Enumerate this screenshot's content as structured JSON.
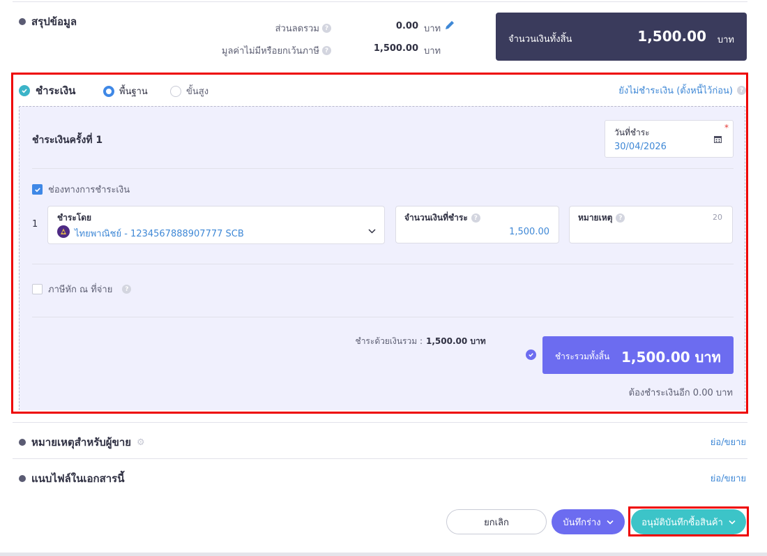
{
  "summary": {
    "title": "สรุปข้อมูล",
    "discount_label": "ส่วนลดรวม",
    "discount_value": "0.00",
    "discount_unit": "บาท",
    "nonvat_label": "มูลค่าไม่มีหรือยกเว้นภาษี",
    "nonvat_value": "1,500.00",
    "nonvat_unit": "บาท",
    "total_label": "จำนวนเงินทั้งสิ้น",
    "total_value": "1,500.00",
    "total_unit": "บาท"
  },
  "payment": {
    "title": "ชำระเงิน",
    "mode_basic": "พื้นฐาน",
    "mode_advanced": "ขั้นสูง",
    "unpaid_link": "ยังไม่ชำระเงิน (ตั้งหนี้ไว้ก่อน)",
    "round_title": "ชำระเงินครั้งที่ 1",
    "date_label": "วันที่ชำระ",
    "date_required": "*",
    "date_value": "30/04/2026",
    "channel_label": "ช่องทางการชำระเงิน",
    "row_index": "1",
    "pay_by_label": "ชำระโดย",
    "pay_by_value": "ไทยพาณิชย์ - 1234567888907777 SCB",
    "amount_label": "จำนวนเงินที่ชำระ",
    "amount_value": "1,500.00",
    "note_label": "หมายเหตุ",
    "note_counter": "20",
    "wht_label": "ภาษีหัก ณ ที่จ่าย",
    "cash_total_label": "ชำระด้วยเงินรวม :",
    "cash_total_value": "1,500.00 บาท",
    "grand_label": "ชำระรวมทั้งสิ้น",
    "grand_value": "1,500.00 บาท",
    "remaining": "ต้องชำระเงินอีก 0.00 บาท"
  },
  "seller_note": {
    "title": "หมายเหตุสำหรับผู้ขาย",
    "toggle": "ย่อ/ขยาย"
  },
  "attachments": {
    "title": "แนบไฟล์ในเอกสารนี้",
    "toggle": "ย่อ/ขยาย"
  },
  "footer": {
    "cancel": "ยกเลิก",
    "save_draft": "บันทึกร่าง",
    "approve": "อนุมัติบันทึกซื้อสินค้า"
  },
  "colors": {
    "accent": "#6c6cf0",
    "dark_total": "#3a3b5c",
    "teal": "#3cc4c8",
    "highlight": "#ee0000"
  }
}
